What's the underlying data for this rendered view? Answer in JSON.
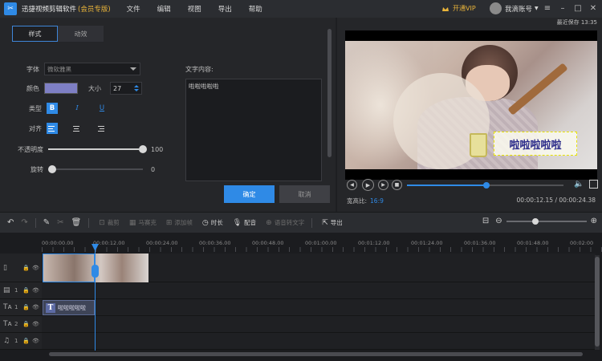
{
  "app": {
    "name": "迅捷视频剪辑软件",
    "edition": "(会员专版)",
    "logo": "app-logo-icon"
  },
  "menu": [
    "文件",
    "编辑",
    "视图",
    "导出",
    "帮助"
  ],
  "vip": {
    "label": "开通VIP",
    "color": "#e9b43a"
  },
  "user": {
    "name": "我滴账号"
  },
  "autosave": "最近保存 13:35",
  "tabs": [
    {
      "label": "样式"
    },
    {
      "label": "动效"
    }
  ],
  "form": {
    "font_label": "字体",
    "font_value": "微软雅黑",
    "color_label": "颜色",
    "color_value": "#7e7fc4",
    "size_label": "大小",
    "size_value": "27",
    "type_label": "类型",
    "type_buttons": [
      "B",
      "I",
      "U"
    ],
    "align_label": "对齐",
    "opacity_label": "不透明度",
    "opacity_value": "100",
    "rotate_label": "旋转",
    "rotate_value": "0",
    "text_label": "文字内容:",
    "text_value": "啦啦啦啦啦",
    "ok_label": "确定",
    "cancel_label": "取消"
  },
  "preview": {
    "overlay_text": "啦啦啦啦啦",
    "aspect_label": "宽高比:",
    "aspect_value": "16:9",
    "timecode": "00:00:12.15 / 00:00:24.38",
    "progress": 0.5
  },
  "toolbar": {
    "items": [
      "裁剪",
      "马赛克",
      "添加帧",
      "时长",
      "配音",
      "语音转文字",
      "导出"
    ]
  },
  "timeline": {
    "ruler_labels": [
      "00:00:00.00",
      "00:00:12.00",
      "00:00:24.00",
      "00:00:36.00",
      "00:00:48.00",
      "00:01:00.00",
      "00:01:12.00",
      "00:01:24.00",
      "00:01:36.00",
      "00:01:48.00",
      "00:02:00"
    ],
    "tracks": [
      {
        "icon": "video-track-icon",
        "num": ""
      },
      {
        "icon": "video-track-icon",
        "num": "1"
      },
      {
        "icon": "text-track-icon",
        "num": "1"
      },
      {
        "icon": "text-track-icon",
        "num": "2"
      },
      {
        "icon": "music-track-icon",
        "num": "1"
      }
    ],
    "text_clip": "啦啦啦啦啦"
  },
  "accent": "#2f8ae6"
}
